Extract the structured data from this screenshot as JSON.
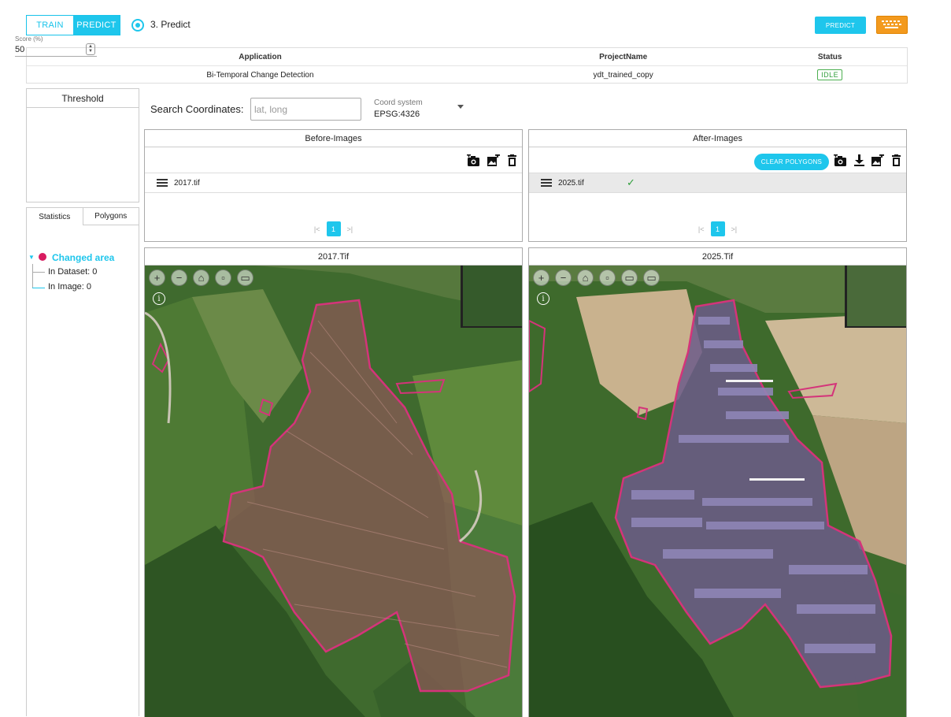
{
  "topbar": {
    "train_label": "TRAIN",
    "predict_mode_label": "PREDICT",
    "step_label": "3. Predict",
    "predict_button": "PREDICT",
    "keyboard_icon": "keyboard-icon",
    "accent_color": "#1ec6ec",
    "keyboard_color": "#f39a1e"
  },
  "info_table": {
    "headers": [
      "Application",
      "ProjectName",
      "Status"
    ],
    "application": "Bi-Temporal Change Detection",
    "project_name": "ydt_trained_copy",
    "status": "IDLE"
  },
  "threshold": {
    "title": "Threshold",
    "score_label": "Score (%)",
    "score_value": "50"
  },
  "side_tabs": [
    "Statistics",
    "Polygons"
  ],
  "statistics": {
    "root": "Changed area",
    "root_color": "#d81b60",
    "in_dataset": "In Dataset: 0",
    "in_image": "In Image: 0"
  },
  "search": {
    "label": "Search Coordinates:",
    "placeholder": "lat, long",
    "coord_label": "Coord system",
    "coord_value": "EPSG:4326"
  },
  "before_images": {
    "title": "Before-Images",
    "file": "2017.tif",
    "page": "1",
    "map_title": "2017.Tif"
  },
  "after_images": {
    "title": "After-Images",
    "clear_button": "CLEAR POLYGONS",
    "file": "2025.tif",
    "page": "1",
    "map_title": "2025.Tif"
  },
  "pager_icons": [
    "first-page-icon",
    "last-page-icon"
  ],
  "polygon_color": "#d4347a"
}
